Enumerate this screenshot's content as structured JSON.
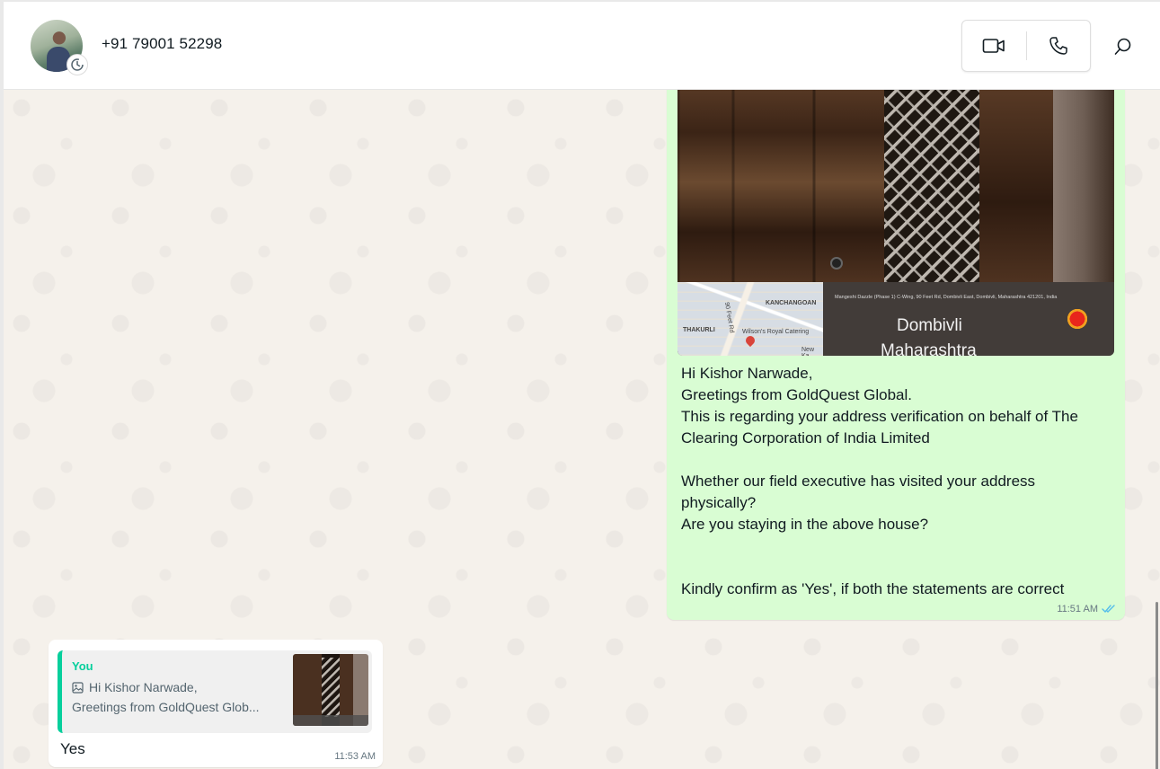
{
  "header": {
    "contact_name": "+91 79001 52298",
    "video_call_icon": "video-camera-icon",
    "voice_call_icon": "phone-icon",
    "search_icon": "search-icon",
    "status_icon": "status-ring-icon"
  },
  "outgoing_message": {
    "image": {
      "map_labels": [
        "KANCHANGOAN",
        "90 Feet Rd",
        "THAKURLI",
        "Wilson's Royal Catering",
        "New Ka"
      ],
      "stamp_address": "Mangeshi Dazzle (Phase 1) C-Wing, 90 Feet Rd, Dombivli East, Dombivli, Maharashtra 421201, India",
      "stamp_city": "Dombivli",
      "stamp_state": "Maharashtra"
    },
    "lines": [
      "Hi Kishor Narwade,",
      "Greetings from GoldQuest Global.",
      "This is regarding your address verification on behalf of The Clearing Corporation of India Limited",
      "",
      "Whether our field executive has visited your address physically?",
      "Are you staying in the above house?",
      "",
      "",
      "Kindly confirm as 'Yes', if both the statements are correct"
    ],
    "time": "11:51 AM",
    "status": "read"
  },
  "incoming_message": {
    "quote": {
      "author": "You",
      "line1": "Hi Kishor Narwade,",
      "line2": "Greetings from GoldQuest Glob..."
    },
    "text": "Yes",
    "time": "11:53 AM"
  },
  "colors": {
    "outgoing_bubble": "#d9fdd3",
    "incoming_bubble": "#ffffff",
    "quote_accent": "#06cf9c",
    "chat_background": "#f5f1eb",
    "read_ticks": "#53bdeb"
  }
}
